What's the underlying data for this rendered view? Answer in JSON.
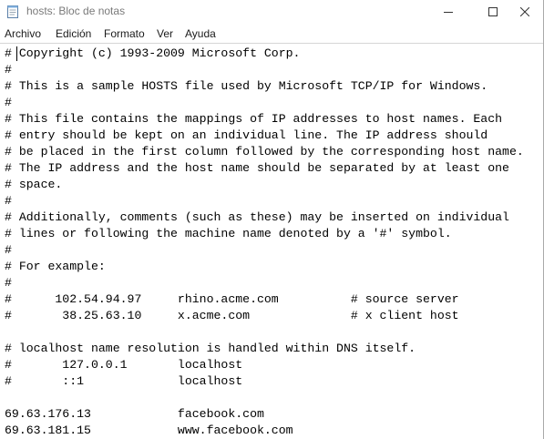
{
  "window": {
    "title": "hosts: Bloc de notas",
    "app_icon": "notepad-icon",
    "caption_icons": [
      "minimize-icon",
      "maximize-icon",
      "close-icon"
    ]
  },
  "menu": {
    "items": [
      {
        "label": "Archivo"
      },
      {
        "label": "Edición"
      },
      {
        "label": "Formato"
      },
      {
        "label": "Ver"
      },
      {
        "label": "Ayuda"
      }
    ]
  },
  "document": {
    "lines": [
      "# Copyright (c) 1993-2009 Microsoft Corp.",
      "#",
      "# This is a sample HOSTS file used by Microsoft TCP/IP for Windows.",
      "#",
      "# This file contains the mappings of IP addresses to host names. Each",
      "# entry should be kept on an individual line. The IP address should",
      "# be placed in the first column followed by the corresponding host name.",
      "# The IP address and the host name should be separated by at least one",
      "# space.",
      "#",
      "# Additionally, comments (such as these) may be inserted on individual",
      "# lines or following the machine name denoted by a '#' symbol.",
      "#",
      "# For example:",
      "#",
      "#      102.54.94.97     rhino.acme.com          # source server",
      "#       38.25.63.10     x.acme.com              # x client host",
      "",
      "# localhost name resolution is handled within DNS itself.",
      "#       127.0.0.1       localhost",
      "#       ::1             localhost",
      "",
      "69.63.176.13            facebook.com",
      "69.63.181.15            www.facebook.com"
    ]
  }
}
